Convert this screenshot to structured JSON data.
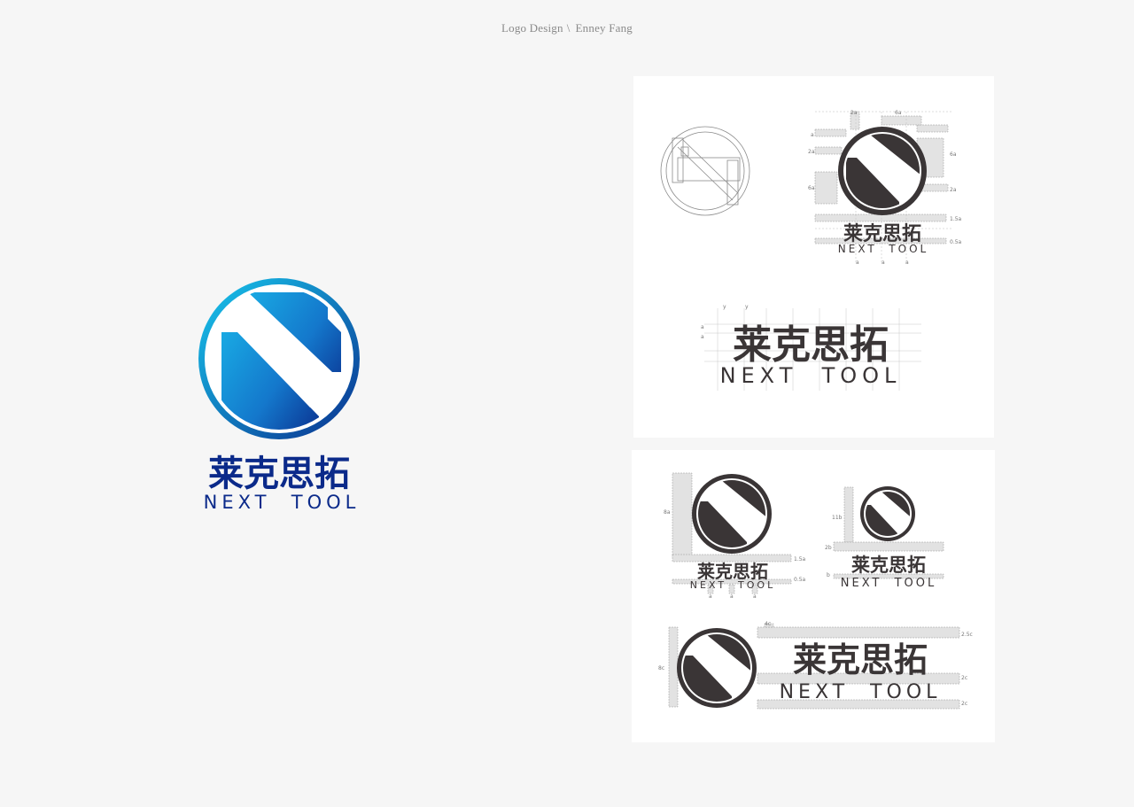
{
  "header": {
    "title": "Logo Design",
    "separator": "\\",
    "author": "Enney Fang"
  },
  "logo": {
    "name_cn": "莱克思拓",
    "name_en": "NEXT  TOOL"
  },
  "colors": {
    "brand_light": "#18c8ee",
    "brand_dark": "#0a2f8e",
    "wordmark": "#0b2a8a",
    "mono": "#3a3536",
    "guide": "#dcdcdc"
  },
  "panel1": {
    "grid_labels": [
      "2a",
      "6a",
      "a",
      "2a",
      "6a",
      "6a",
      "2a",
      "1.5a",
      "0.5a",
      "a",
      "a",
      "a"
    ],
    "wordmark_labels": [
      "y",
      "y",
      "a",
      "a"
    ]
  },
  "panel2": {
    "labels_a": [
      "8a",
      "1.5a",
      "0.5a",
      "a",
      "a",
      "a"
    ],
    "labels_b": [
      "11b",
      "2b",
      "b"
    ],
    "labels_c": [
      "4c",
      "8c",
      "2.5c",
      "2c",
      "2c"
    ]
  }
}
